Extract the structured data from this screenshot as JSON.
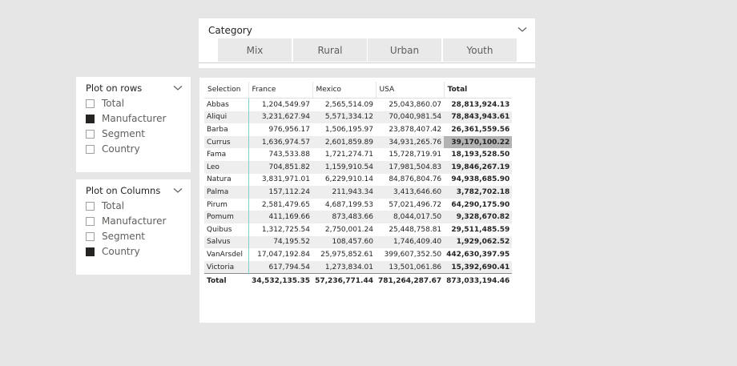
{
  "category_slicer": {
    "title": "Category",
    "tiles": [
      "Mix",
      "Rural",
      "Urban",
      "Youth"
    ]
  },
  "plot_rows": {
    "title": "Plot on rows",
    "options": [
      {
        "label": "Total",
        "checked": false
      },
      {
        "label": "Manufacturer",
        "checked": true
      },
      {
        "label": "Segment",
        "checked": false
      },
      {
        "label": "Country",
        "checked": false
      }
    ]
  },
  "plot_columns": {
    "title": "Plot on Columns",
    "options": [
      {
        "label": "Total",
        "checked": false
      },
      {
        "label": "Manufacturer",
        "checked": false
      },
      {
        "label": "Segment",
        "checked": false
      },
      {
        "label": "Country",
        "checked": true
      }
    ]
  },
  "matrix": {
    "headers": [
      "Selection",
      "France",
      "Mexico",
      "USA",
      "Total"
    ],
    "rows": [
      [
        "Abbas",
        "1,204,549.97",
        "2,565,514.09",
        "25,043,860.07",
        "28,813,924.13"
      ],
      [
        "Aliqui",
        "3,231,627.94",
        "5,571,334.12",
        "70,040,981.54",
        "78,843,943.61"
      ],
      [
        "Barba",
        "976,956.17",
        "1,506,195.97",
        "23,878,407.42",
        "26,361,559.56"
      ],
      [
        "Currus",
        "1,636,974.57",
        "2,601,859.89",
        "34,931,265.76",
        "39,170,100.22"
      ],
      [
        "Fama",
        "743,533.88",
        "1,721,274.71",
        "15,728,719.91",
        "18,193,528.50"
      ],
      [
        "Leo",
        "704,851.82",
        "1,159,910.54",
        "17,981,504.83",
        "19,846,267.19"
      ],
      [
        "Natura",
        "3,831,971.01",
        "6,229,910.14",
        "84,876,804.76",
        "94,938,685.90"
      ],
      [
        "Palma",
        "157,112.24",
        "211,943.34",
        "3,413,646.60",
        "3,782,702.18"
      ],
      [
        "Pirum",
        "2,581,479.65",
        "4,687,199.53",
        "57,021,496.72",
        "64,290,175.90"
      ],
      [
        "Pomum",
        "411,169.66",
        "873,483.66",
        "8,044,017.50",
        "9,328,670.82"
      ],
      [
        "Quibus",
        "1,312,725.54",
        "2,750,001.24",
        "25,448,758.81",
        "29,511,485.59"
      ],
      [
        "Salvus",
        "74,195.52",
        "108,457.60",
        "1,746,409.40",
        "1,929,062.52"
      ],
      [
        "VanArsdel",
        "17,047,192.84",
        "25,975,852.61",
        "399,607,352.50",
        "442,630,397.95"
      ],
      [
        "Victoria",
        "617,794.54",
        "1,273,834.01",
        "13,501,061.86",
        "15,392,690.41"
      ]
    ],
    "highlighted_row": "Currus",
    "grand_total": [
      "Total",
      "34,532,135.35",
      "57,236,771.44",
      "781,264,287.67",
      "873,033,194.46"
    ]
  },
  "colors": {
    "background": "#e6e6e6",
    "panel": "#ffffff",
    "tile": "#e9e9e9",
    "highlight": "#b3b3b3",
    "row_separator": "#7ecfd0"
  }
}
